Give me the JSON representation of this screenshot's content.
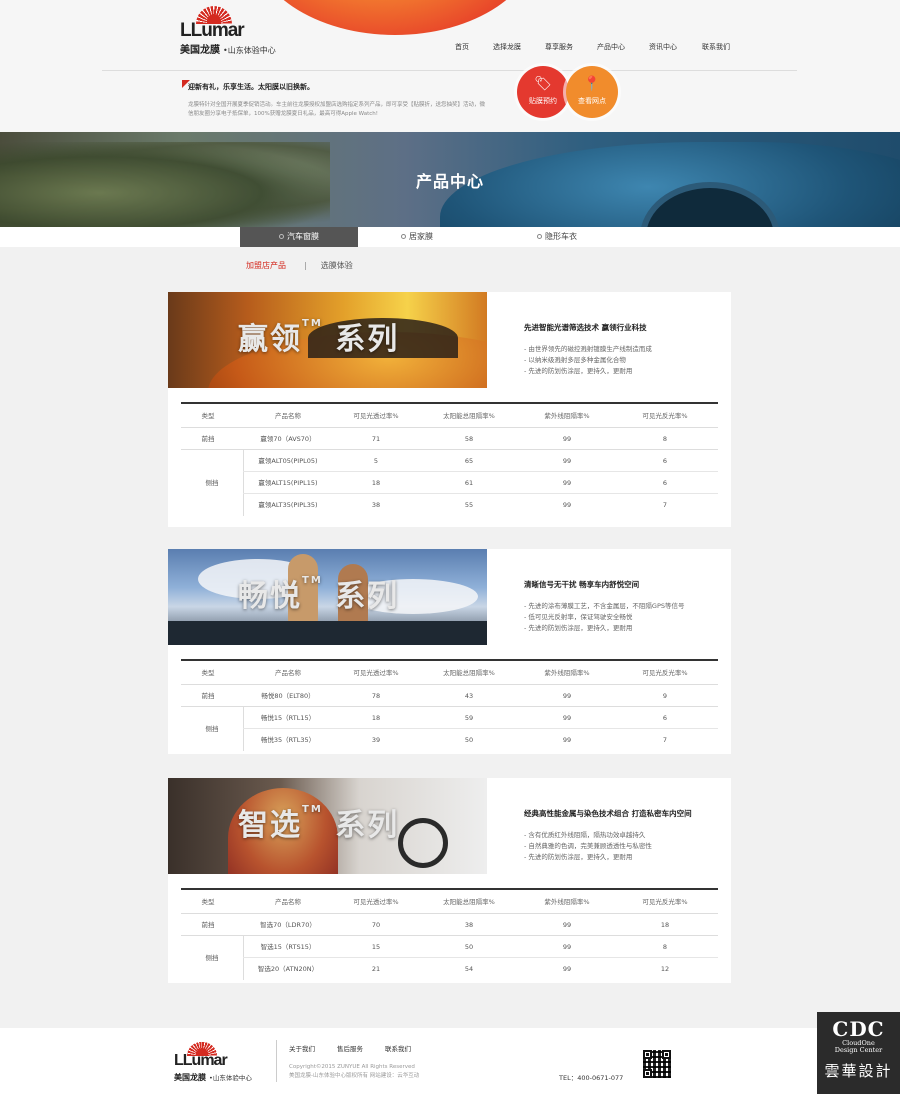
{
  "brand": {
    "word": "LLumar",
    "name": "美国龙膜",
    "tagline": "山东体验中心"
  },
  "nav": [
    "首页",
    "选择龙膜",
    "尊享服务",
    "产品中心",
    "资讯中心",
    "联系我们"
  ],
  "promo": {
    "title": "迎新有礼，乐享生活。太阳膜以旧换新。",
    "desc": "龙膜特针对全国开展夏季促销活动。车主前往龙膜授权加盟店选购指定系列产品，即可享受【贴膜折，送您抽奖】活动，微信朋友圈分享电子抵保单，100%获赠龙膜夏日礼品，最高可得Apple Watch!"
  },
  "circles": {
    "book": "贴膜预约",
    "locate": "查看网点"
  },
  "banner_title": "产品中心",
  "tabs": [
    "汽车窗膜",
    "居家膜",
    "隐形车衣"
  ],
  "subnav": {
    "active": "加盟店产品",
    "sep": "|",
    "other": "选膜体验"
  },
  "table_headers": [
    "类型",
    "产品名称",
    "可见光透过率%",
    "太阳能总阻隔率%",
    "紫外线阻隔率%",
    "可见光反光率%"
  ],
  "products": [
    {
      "title": "赢领",
      "tm": "TM",
      "suffix": "系列",
      "headline": "先进智能光谱筛选技术 赢领行业科技",
      "features": [
        "- 由世界领先的磁控溅射镀膜生产线制造而成",
        "- 以纳米级溅射多层多种金属化合物",
        "- 先进的防划伤涂层，更持久，更耐用"
      ],
      "front": {
        "type": "前挡",
        "name": "赢领70（AVS70）",
        "vlt": "71",
        "tser": "58",
        "uv": "99",
        "vlr": "8"
      },
      "side_type": "侧挡",
      "side": [
        {
          "name": "赢领ALT05(PIPL05)",
          "vlt": "5",
          "tser": "65",
          "uv": "99",
          "vlr": "6"
        },
        {
          "name": "赢领ALT15(PIPL15)",
          "vlt": "18",
          "tser": "61",
          "uv": "99",
          "vlr": "6"
        },
        {
          "name": "赢领ALT35(PIPL35)",
          "vlt": "38",
          "tser": "55",
          "uv": "99",
          "vlr": "7"
        }
      ]
    },
    {
      "title": "畅悦",
      "tm": "TM",
      "suffix": "系列",
      "headline": "清晰信号无干扰 畅享车内舒悦空间",
      "features": [
        "- 先进的涂布薄膜工艺，不含金属层，不阻隔GPS等信号",
        "- 低可见光反射率，保证驾驶安全畅悦",
        "- 先进的防划伤涂层，更持久，更耐用"
      ],
      "front": {
        "type": "前挡",
        "name": "畅悦80（ELT80）",
        "vlt": "78",
        "tser": "43",
        "uv": "99",
        "vlr": "9"
      },
      "side_type": "侧挡",
      "side": [
        {
          "name": "畅悦15（RTL15）",
          "vlt": "18",
          "tser": "59",
          "uv": "99",
          "vlr": "6"
        },
        {
          "name": "畅悦35（RTL35）",
          "vlt": "39",
          "tser": "50",
          "uv": "99",
          "vlr": "7"
        }
      ]
    },
    {
      "title": "智选",
      "tm": "TM",
      "suffix": "系列",
      "headline": "经典高性能金属与染色技术组合 打造私密车内空间",
      "features": [
        "- 含有优质红外线阻隔，隔热功效卓越持久",
        "- 自然典雅的色调，完美兼顾透透性与私密性",
        "- 先进的防划伤涂层，更持久，更耐用"
      ],
      "front": {
        "type": "前挡",
        "name": "智选70（LDR70）",
        "vlt": "70",
        "tser": "38",
        "uv": "99",
        "vlr": "18"
      },
      "side_type": "侧挡",
      "side": [
        {
          "name": "智选15（RTS15）",
          "vlt": "15",
          "tser": "50",
          "uv": "99",
          "vlr": "8"
        },
        {
          "name": "智选20（ATN20N）",
          "vlt": "21",
          "tser": "54",
          "uv": "99",
          "vlr": "12"
        }
      ]
    }
  ],
  "footer": {
    "links": [
      "关于我们",
      "售后服务",
      "联系我们"
    ],
    "copyright": "Copyright©2015 ZUNYUE All Rights Reserved",
    "copyright2": "美国龙膜-山东体验中心版权所有 网站建设：云华互动",
    "tel": "TEL：400-0671-077"
  },
  "watermark": {
    "a": "CDC",
    "b": "CloudOne\nDesign Center",
    "c": "雲華設計"
  },
  "colors": {
    "accent": "#d42a20",
    "orange": "#f18c2c",
    "tab_active": "#555555"
  }
}
